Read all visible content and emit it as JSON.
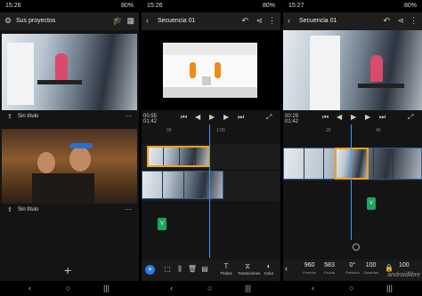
{
  "screen1": {
    "status": {
      "time": "15:26",
      "battery": "80%"
    },
    "header": {
      "title": "Sus proyectos",
      "settings_icon": "gear-icon",
      "icons": [
        "graduation-cap-icon",
        "grid-icon"
      ]
    },
    "projects": [
      {
        "label": "Sin título",
        "icon": "share-icon",
        "menu": "···"
      },
      {
        "label": "Sin título",
        "icon": "share-icon",
        "menu": "···"
      }
    ],
    "fab": "+"
  },
  "screen2": {
    "status": {
      "time": "15:26",
      "battery": "80%"
    },
    "header": {
      "title": "Secuencia 01",
      "back": "‹",
      "icons": [
        "undo-icon",
        "share-icon",
        "more-icon"
      ]
    },
    "playback": {
      "current": "00:55",
      "total": "01:42",
      "btns": [
        "⏮",
        "◀",
        "▶",
        "▶",
        "⏭"
      ]
    },
    "ruler": [
      "00",
      "1:00"
    ],
    "audio_label": "V",
    "tools": [
      {
        "label": "Títulos",
        "icon": "title-icon"
      },
      {
        "label": "Transiciones",
        "icon": "transitions-icon"
      },
      {
        "label": "Color",
        "icon": "color-icon"
      }
    ],
    "tool_icons": [
      "crop-icon",
      "split-icon",
      "delete-icon",
      "layers-icon"
    ]
  },
  "screen3": {
    "status": {
      "time": "15:27",
      "battery": "80%"
    },
    "header": {
      "title": "Secuencia 01",
      "back": "‹",
      "icons": [
        "undo-icon",
        "share-icon",
        "more-icon"
      ]
    },
    "playback": {
      "current": "00:29",
      "total": "01:42",
      "btns": [
        "⏮",
        "◀",
        "▶",
        "▶",
        "⏭"
      ]
    },
    "ruler": [
      "20",
      "40"
    ],
    "audio_label": "V",
    "params": [
      {
        "value": "960",
        "label": "Posición"
      },
      {
        "value": "583",
        "label": "Escala"
      },
      {
        "value": "0°",
        "label": "Rotación"
      },
      {
        "value": "100",
        "label": "Opacidad"
      },
      {
        "value": "100",
        "label": ""
      }
    ],
    "watermark": "androidlibre"
  },
  "navbar": [
    "‹",
    "○",
    "|||"
  ]
}
